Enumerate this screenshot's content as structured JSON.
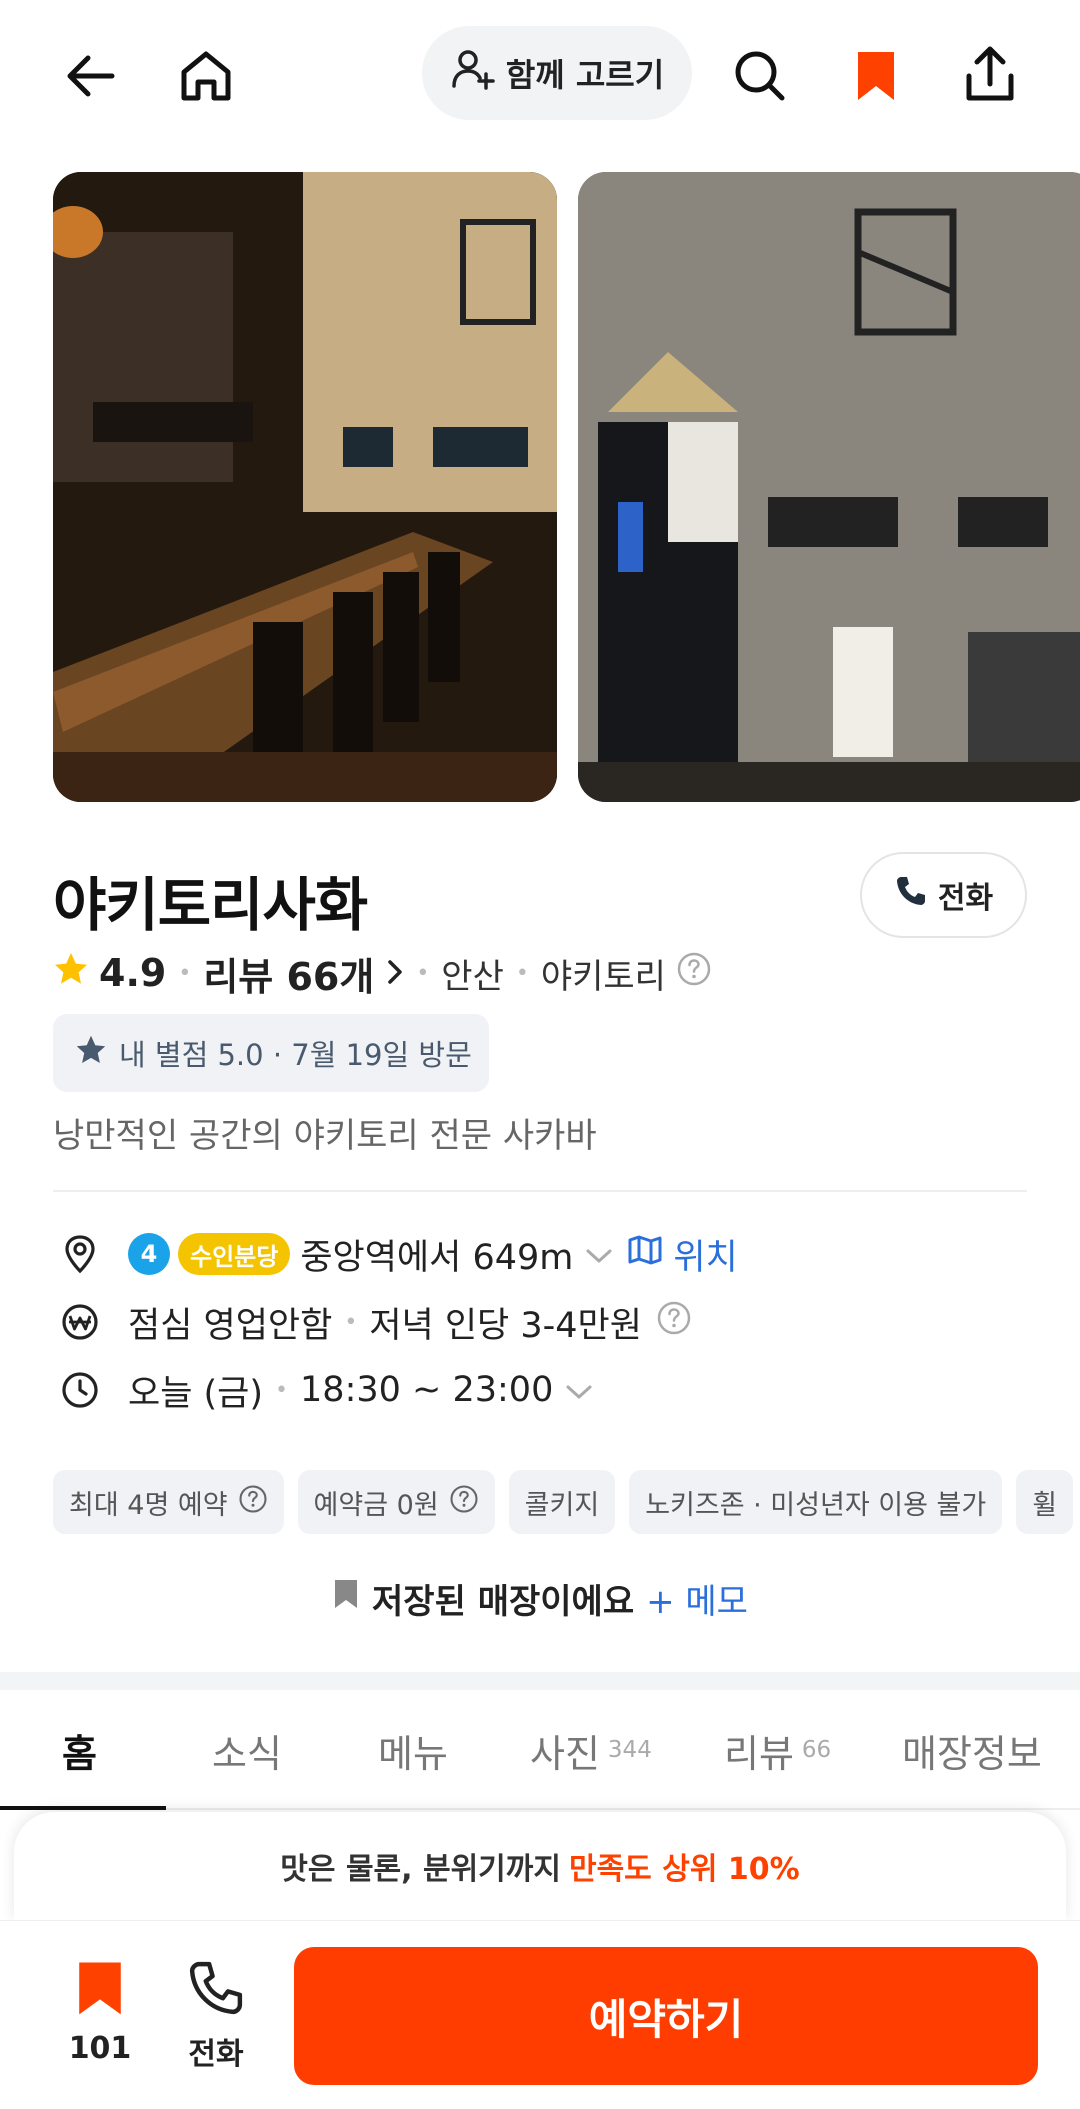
{
  "header": {
    "together_label": "함께 고르기",
    "bookmark_color": "#ff4100"
  },
  "store": {
    "name": "야키토리사화",
    "call_label": "전화",
    "rating": "4.9",
    "reviews": "리뷰 66개",
    "region": "안산",
    "category": "야키토리",
    "my_rating": "내 별점 5.0 · 7월 19일 방문",
    "description": "낭만적인 공간의 야키토리 전문 사카바"
  },
  "info": {
    "line_number": "4",
    "line_name": "수인분당",
    "distance": "중앙역에서 649m",
    "location_link": "위치",
    "lunch": "점심 영업안함",
    "dinner": "저녁 인당 3-4만원",
    "hours_day": "오늘 (금)",
    "hours_time": "18:30 ~ 23:00"
  },
  "chips": [
    "최대 4명 예약",
    "예약금 0원",
    "콜키지",
    "노키즈존 · 미성년자 이용 불가",
    "휠"
  ],
  "saved": {
    "text": "저장된 매장이에요",
    "memo": "+ 메모"
  },
  "tabs": [
    {
      "label": "홈",
      "count": ""
    },
    {
      "label": "소식",
      "count": ""
    },
    {
      "label": "메뉴",
      "count": ""
    },
    {
      "label": "사진",
      "count": "344"
    },
    {
      "label": "리뷰",
      "count": "66"
    },
    {
      "label": "매장정보",
      "count": ""
    }
  ],
  "promo": {
    "text": "맛은 물론, 분위기까지",
    "highlight": "만족도 상위 10%"
  },
  "bottom_bar": {
    "save_count": "101",
    "call_label": "전화",
    "reserve_label": "예약하기",
    "accent": "#ff3d00"
  }
}
